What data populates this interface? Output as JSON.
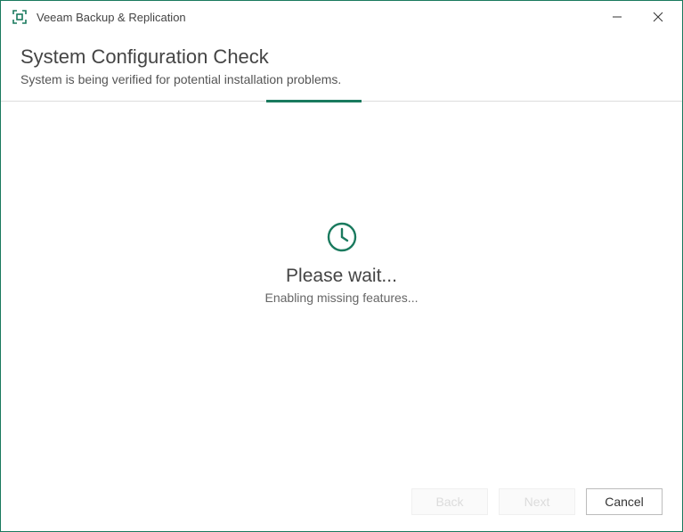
{
  "app": {
    "title": "Veeam Backup & Replication"
  },
  "header": {
    "title": "System Configuration Check",
    "subtitle": "System is being verified for potential installation problems."
  },
  "progress": {
    "segment_left_pct": 39,
    "segment_width_pct": 14
  },
  "wait": {
    "title": "Please wait...",
    "subtitle": "Enabling missing features..."
  },
  "footer": {
    "back_label": "Back",
    "next_label": "Next",
    "cancel_label": "Cancel"
  },
  "colors": {
    "accent": "#1a7a5e"
  }
}
